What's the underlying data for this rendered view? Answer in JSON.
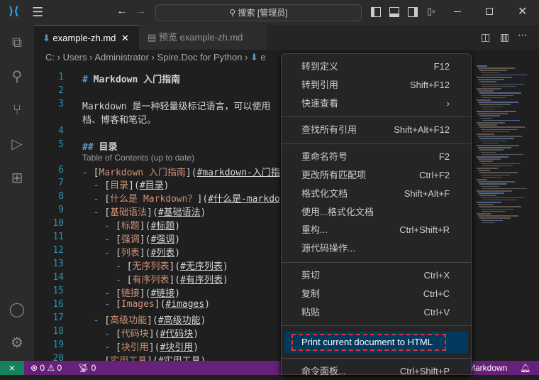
{
  "titlebar": {
    "search": "搜索 [管理员]"
  },
  "tabs": [
    {
      "label": "example-zh.md",
      "active": true
    },
    {
      "label": "预览 example-zh.md",
      "active": false
    }
  ],
  "breadcrumb": [
    "C:",
    "Users",
    "Administrator",
    "Spire.Doc for Python",
    "e"
  ],
  "editor": {
    "lines": [
      {
        "n": "1",
        "t": "heading"
      },
      {
        "n": "2"
      },
      {
        "n": "3"
      },
      {
        "n": ""
      },
      {
        "n": "4"
      },
      {
        "n": "5"
      },
      {
        "n": ""
      },
      {
        "n": "6"
      },
      {
        "n": "7"
      },
      {
        "n": "8"
      },
      {
        "n": "9"
      },
      {
        "n": "10"
      },
      {
        "n": "11"
      },
      {
        "n": "12"
      },
      {
        "n": "13"
      },
      {
        "n": "14"
      },
      {
        "n": "15"
      },
      {
        "n": "16"
      },
      {
        "n": "17"
      },
      {
        "n": "18"
      },
      {
        "n": "19"
      },
      {
        "n": "20"
      }
    ],
    "h1_mark": "#",
    "h1_text": "Markdown 入门指南",
    "p3": "Markdown 是一种轻量级标记语言，可以使用",
    "p3b": "档、博客和笔记。",
    "h2_mark": "##",
    "h2_text": "目录",
    "codelens": "Table of Contents (up to date)",
    "toc": [
      {
        "indent": 0,
        "text": "Markdown 入门指南",
        "link": "#markdown-入门指"
      },
      {
        "indent": 1,
        "text": "目录",
        "link": "#目录"
      },
      {
        "indent": 1,
        "text": "什么是 Markdown？",
        "link": "#什么是-markdo"
      },
      {
        "indent": 1,
        "text": "基础语法",
        "link": "#基础语法"
      },
      {
        "indent": 2,
        "text": "标题",
        "link": "#标题"
      },
      {
        "indent": 2,
        "text": "强调",
        "link": "#强调"
      },
      {
        "indent": 2,
        "text": "列表",
        "link": "#列表"
      },
      {
        "indent": 3,
        "text": "无序列表",
        "link": "#无序列表"
      },
      {
        "indent": 3,
        "text": "有序列表",
        "link": "#有序列表"
      },
      {
        "indent": 2,
        "text": "链接",
        "link": "#链接"
      },
      {
        "indent": 2,
        "text": "Images",
        "link": "#images"
      },
      {
        "indent": 1,
        "text": "高级功能",
        "link": "#高级功能"
      },
      {
        "indent": 2,
        "text": "代码块",
        "link": "#代码块"
      },
      {
        "indent": 2,
        "text": "块引用",
        "link": "#块引用"
      },
      {
        "indent": 1,
        "text": "实用工具",
        "link": "#实用工具"
      }
    ]
  },
  "menu": {
    "groups": [
      [
        {
          "label": "转到定义",
          "key": "F12"
        },
        {
          "label": "转到引用",
          "key": "Shift+F12"
        },
        {
          "label": "快速查看",
          "key": "›"
        }
      ],
      [
        {
          "label": "查找所有引用",
          "key": "Shift+Alt+F12"
        }
      ],
      [
        {
          "label": "重命名符号",
          "key": "F2"
        },
        {
          "label": "更改所有匹配项",
          "key": "Ctrl+F2"
        },
        {
          "label": "格式化文档",
          "key": "Shift+Alt+F"
        },
        {
          "label": "使用...格式化文档",
          "key": ""
        },
        {
          "label": "重构...",
          "key": "Ctrl+Shift+R"
        },
        {
          "label": "源代码操作...",
          "key": ""
        }
      ],
      [
        {
          "label": "剪切",
          "key": "Ctrl+X"
        },
        {
          "label": "复制",
          "key": "Ctrl+C"
        },
        {
          "label": "粘贴",
          "key": "Ctrl+V"
        }
      ],
      [
        {
          "label": "Print current document to HTML",
          "key": "",
          "highlighted": true
        }
      ],
      [
        {
          "label": "命令面板...",
          "key": "Ctrl+Shift+P"
        }
      ]
    ]
  },
  "status": {
    "errors": "0",
    "warnings": "0",
    "ports": "0",
    "language": "Markdown"
  },
  "colors": {
    "status": "#68217a",
    "remote": "#16825d",
    "highlight": "#04395e",
    "accent": "#0078d4"
  }
}
